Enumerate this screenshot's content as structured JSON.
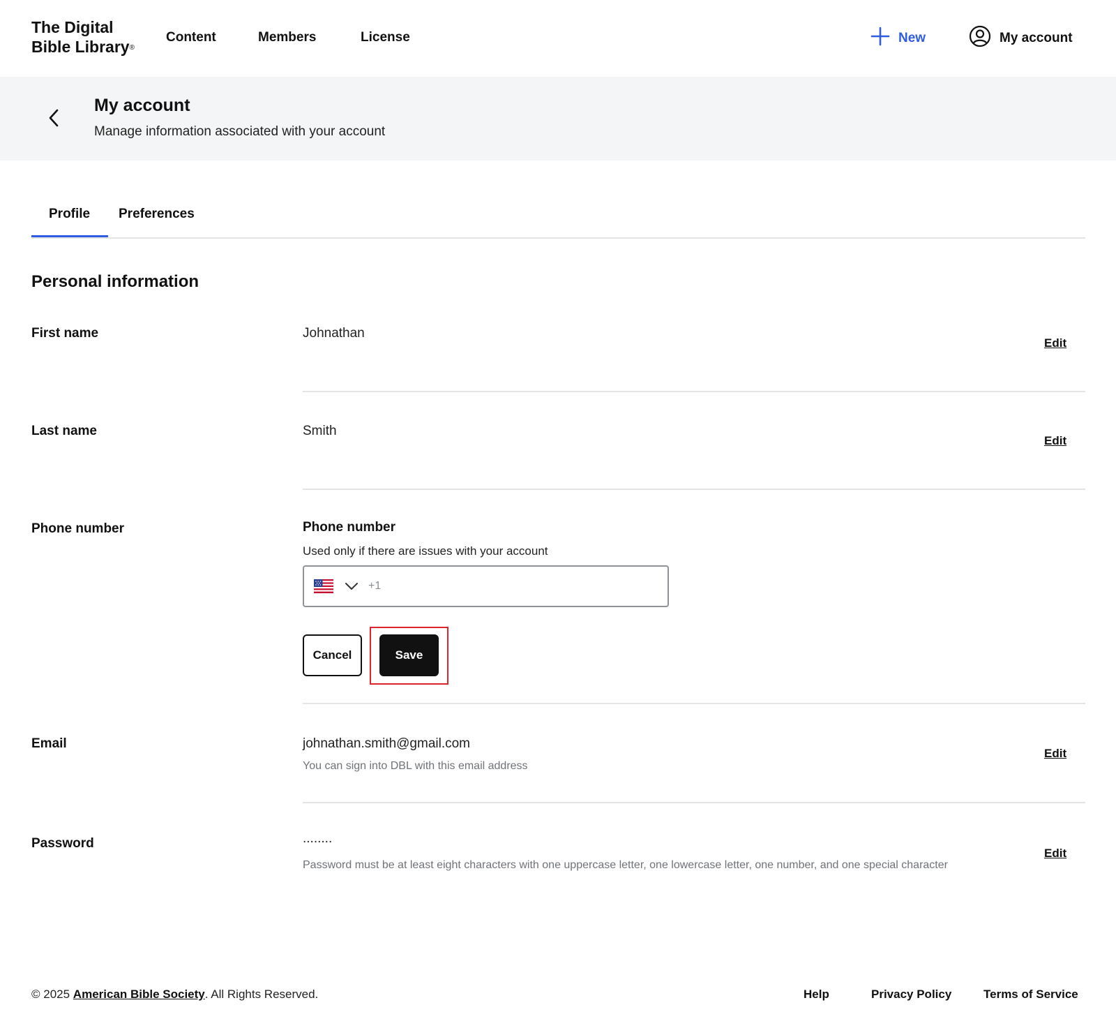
{
  "brand": {
    "line1": "The Digital",
    "line2": "Bible Library",
    "mark": "®"
  },
  "nav": {
    "content": "Content",
    "members": "Members",
    "license": "License",
    "new": "New",
    "account": "My account"
  },
  "colors": {
    "accent": "#2f5ce0",
    "highlight": "#e0242a",
    "header_bg": "#f4f5f6"
  },
  "header": {
    "title": "My account",
    "subtitle": "Manage information associated with your account"
  },
  "tabs": [
    {
      "label": "Profile",
      "active": true
    },
    {
      "label": "Preferences",
      "active": false
    }
  ],
  "section": {
    "title": "Personal information"
  },
  "fields": {
    "first_name": {
      "label": "First name",
      "value": "Johnathan",
      "edit": "Edit"
    },
    "last_name": {
      "label": "Last name",
      "value": "Smith",
      "edit": "Edit"
    },
    "phone": {
      "label": "Phone number",
      "title": "Phone number",
      "help": "Used only if there are issues with your account",
      "country": "us-flag-icon",
      "dial_code": "+1",
      "value": "",
      "cancel": "Cancel",
      "save": "Save"
    },
    "email": {
      "label": "Email",
      "value": "johnathan.smith@gmail.com",
      "help": "You can sign into DBL with this email address",
      "edit": "Edit"
    },
    "password": {
      "label": "Password",
      "value": "........",
      "help": "Password must be at least eight characters with one uppercase letter, one lowercase letter, one number, and one special character",
      "edit": "Edit"
    }
  },
  "footer": {
    "copyright_prefix": "© 2025 ",
    "org": "American Bible Society",
    "copyright_suffix": ". All Rights Reserved.",
    "help": "Help",
    "privacy": "Privacy Policy",
    "terms": "Terms of Service"
  }
}
